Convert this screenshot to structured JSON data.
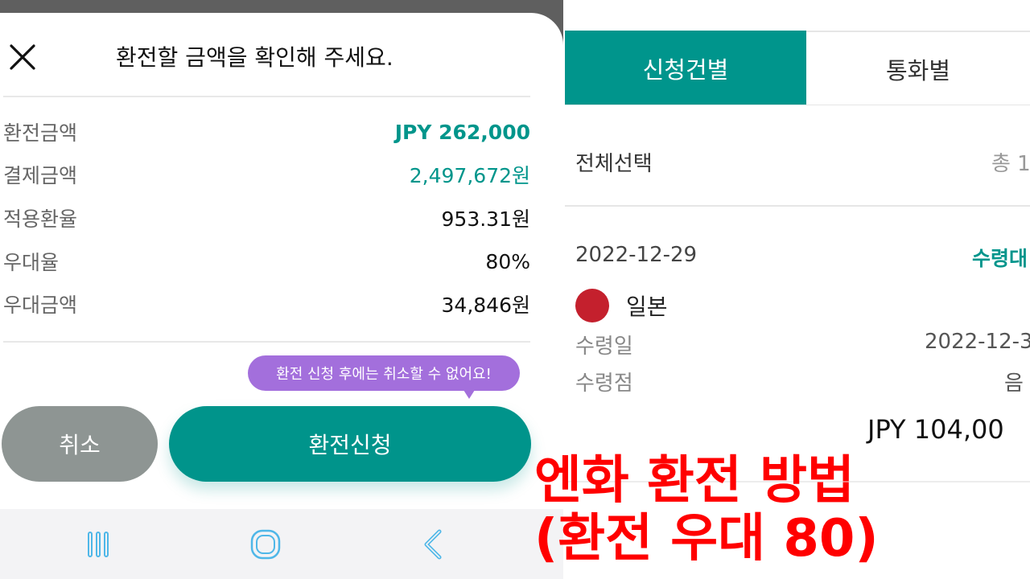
{
  "dialog": {
    "title": "환전할 금액을 확인해 주세요.",
    "rows": [
      {
        "label": "환전금액",
        "value": "JPY 262,000"
      },
      {
        "label": "결제금액",
        "value": "2,497,672원"
      },
      {
        "label": "적용환율",
        "value": "953.31원"
      },
      {
        "label": "우대율",
        "value": "80%"
      },
      {
        "label": "우대금액",
        "value": "34,846원"
      }
    ],
    "tooltip": "환전 신청 후에는 취소할 수 없어요!",
    "cancel_label": "취소",
    "submit_label": "환전신청"
  },
  "navbar": {
    "icons": [
      "recent-apps-icon",
      "home-icon",
      "back-icon"
    ]
  },
  "list": {
    "tabs": [
      {
        "label": "신청건별",
        "active": true
      },
      {
        "label": "통화별",
        "active": false
      }
    ],
    "select_all": "전체선택",
    "total": "총 1",
    "card": {
      "date": "2022-12-29",
      "status": "수령대",
      "country": "일본",
      "receive_date_label": "수령일",
      "receive_date_value": "2022-12-3",
      "receive_place_label": "수령점",
      "receive_place_value": "음",
      "amount": "JPY  104,00"
    }
  },
  "caption": {
    "line1": "엔화 환전 방법",
    "line2": "(환전 우대 80)"
  },
  "colors": {
    "accent": "#00958b",
    "tooltip": "#a36fdc",
    "cancel": "#8e9593",
    "caption": "#ff0000",
    "flag": "#c4202d"
  }
}
